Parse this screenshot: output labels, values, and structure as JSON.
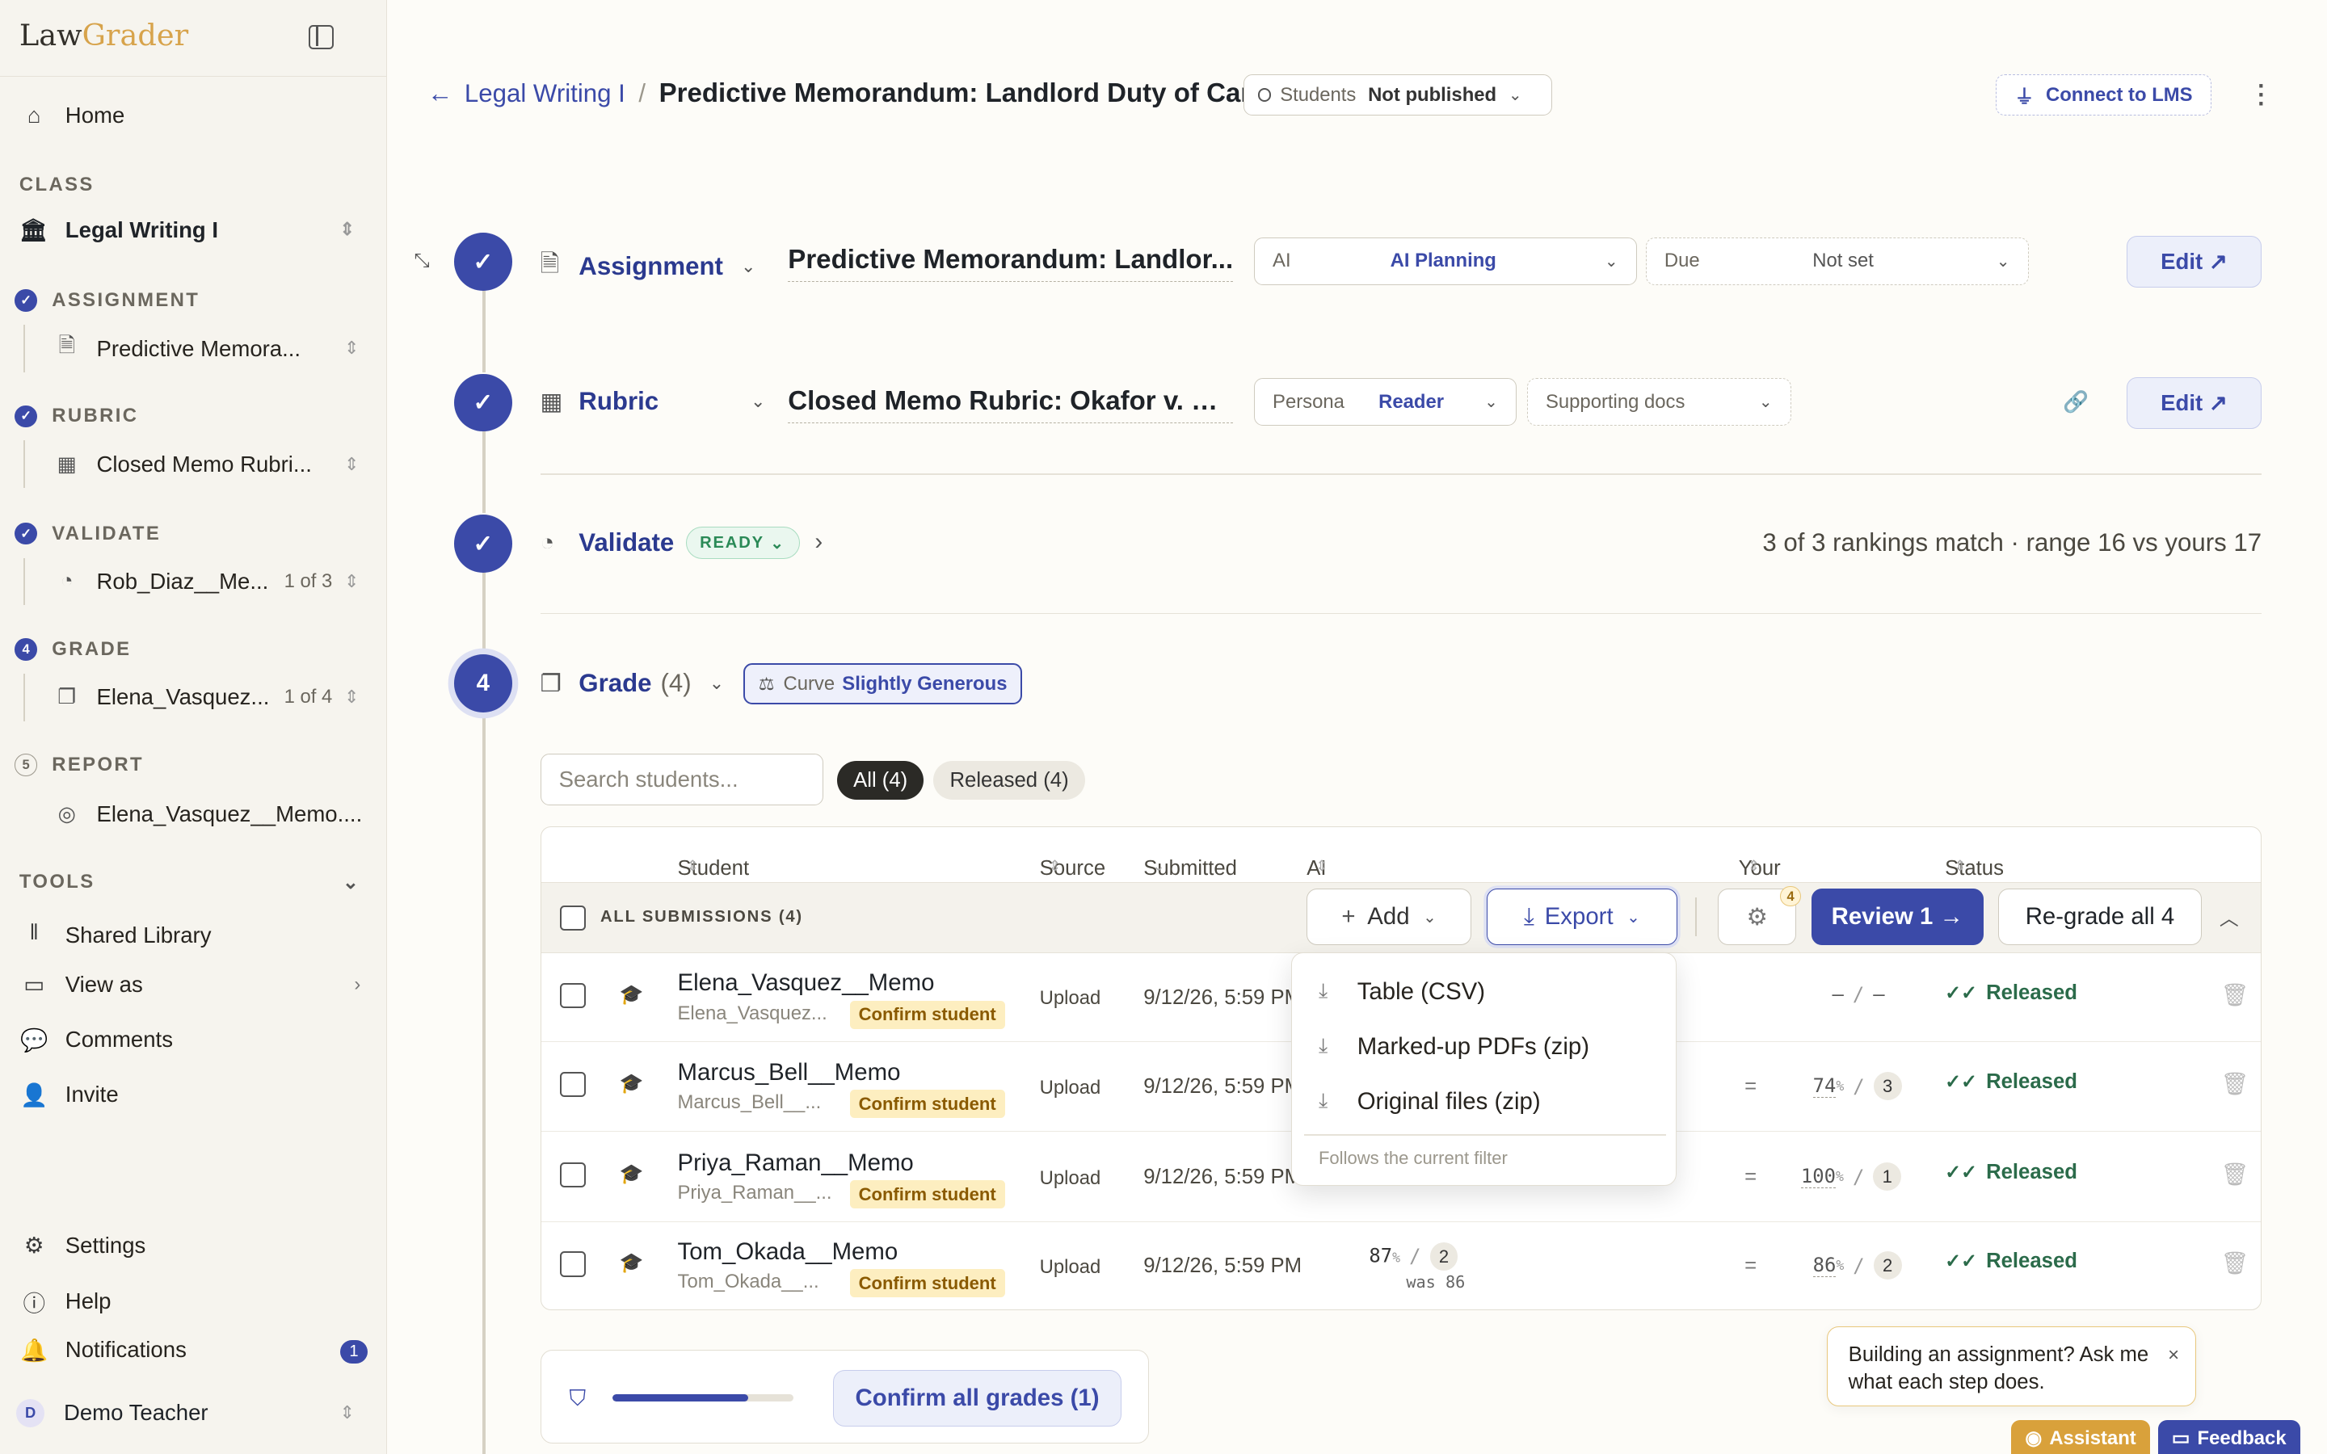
{
  "app": {
    "logo_text_a": "Law",
    "logo_text_b": "Grader"
  },
  "sidebar": {
    "home": "Home",
    "class_label": "CLASS",
    "class_name": "Legal Writing I",
    "assignment_label": "ASSIGNMENT",
    "assignment_item": "Predictive Memora...",
    "rubric_label": "RUBRIC",
    "rubric_item": "Closed Memo Rubri...",
    "validate_label": "VALIDATE",
    "validate_item": "Rob_Diaz__Me...",
    "validate_count": "1 of 3",
    "grade_step": "4",
    "grade_label": "GRADE",
    "grade_item": "Elena_Vasquez...",
    "grade_count": "1 of 4",
    "report_step": "5",
    "report_label": "REPORT",
    "report_item": "Elena_Vasquez__Memo....",
    "tools_label": "TOOLS",
    "tools": [
      "Shared Library",
      "View as",
      "Comments",
      "Invite"
    ],
    "settings": "Settings",
    "help": "Help",
    "notifications": "Notifications",
    "notifications_count": "1",
    "user_initial": "D",
    "user_name": "Demo Teacher"
  },
  "header": {
    "class_link": "Legal Writing I",
    "separator": "/",
    "title": "Predictive Memorandum: Landlord Duty of Care",
    "students_label": "Students",
    "students_value": "Not published",
    "connect_lms": "Connect to LMS"
  },
  "steps": {
    "assignment": {
      "name": "Assignment",
      "doc_title": "Predictive Memorandum: Landlor...",
      "ai_key": "AI",
      "ai_value": "AI Planning",
      "due_key": "Due",
      "due_value": "Not set",
      "edit": "Edit ↗"
    },
    "rubric": {
      "name": "Rubric",
      "doc_title": "Closed Memo Rubric: Okafor v. Ha...",
      "persona_key": "Persona",
      "persona_value": "Reader",
      "supporting": "Supporting docs",
      "edit": "Edit ↗"
    },
    "validate": {
      "name": "Validate",
      "badge": "READY",
      "summary": "3 of 3 rankings match · range 16 vs yours 17"
    },
    "grade": {
      "number": "4",
      "name": "Grade",
      "count": "(4)",
      "curve_key": "Curve",
      "curve_value": "Slightly Generous"
    }
  },
  "filters": {
    "search_placeholder": "Search students...",
    "all_chip": "All (4)",
    "released_chip": "Released (4)"
  },
  "table": {
    "headers": {
      "student": "Student",
      "source": "Source",
      "submitted": "Submitted",
      "ai_score": "AI Score/Rank",
      "your_score": "Your Score/Rank",
      "status": "Status"
    },
    "all_submissions": "ALL SUBMISSIONS (4)",
    "add": "Add",
    "export": "Export",
    "gear_badge": "4",
    "review": "Review 1 →",
    "regrade": "Re-grade all 4",
    "rows": [
      {
        "name": "Elena_Vasquez__Memo",
        "sub": "Elena_Vasquez...",
        "confirm": "Confirm student",
        "source": "Upload",
        "submitted": "9/12/26, 5:59 PM",
        "ai_score": "",
        "ai_rank": "",
        "was": "",
        "eq": "",
        "your_score": "–",
        "your_rank": "–",
        "status": "Released"
      },
      {
        "name": "Marcus_Bell__Memo",
        "sub": "Marcus_Bell__...",
        "confirm": "Confirm student",
        "source": "Upload",
        "submitted": "9/12/26, 5:59 PM",
        "ai_score": "",
        "ai_rank": "",
        "was": "",
        "eq": "=",
        "your_score": "74",
        "your_rank": "3",
        "status": "Released"
      },
      {
        "name": "Priya_Raman__Memo",
        "sub": "Priya_Raman__...",
        "confirm": "Confirm student",
        "source": "Upload",
        "submitted": "9/12/26, 5:59 PM",
        "ai_score": "",
        "ai_rank": "",
        "was": "",
        "eq": "=",
        "your_score": "100",
        "your_rank": "1",
        "status": "Released"
      },
      {
        "name": "Tom_Okada__Memo",
        "sub": "Tom_Okada__...",
        "confirm": "Confirm student",
        "source": "Upload",
        "submitted": "9/12/26, 5:59 PM",
        "ai_score": "87",
        "ai_rank": "2",
        "was": "was 86",
        "eq": "=",
        "your_score": "86",
        "your_rank": "2",
        "status": "Released"
      }
    ],
    "percent_sign": "%"
  },
  "export_menu": {
    "items": [
      "Table (CSV)",
      "Marked-up PDFs (zip)",
      "Original files (zip)"
    ],
    "note": "Follows the current filter"
  },
  "bottom": {
    "progress": 0.75,
    "confirm_all": "Confirm all grades (1)"
  },
  "tip": {
    "text": "Building an assignment? Ask me what each step does.",
    "close": "×"
  },
  "footer_buttons": {
    "assistant": "Assistant",
    "feedback": "Feedback"
  },
  "colors": {
    "accent": "#3b4aa8",
    "released": "#2b6b4a",
    "confirm_bg": "#fdeec0",
    "ready": "#2b8a57",
    "assistant": "#d9a13b"
  }
}
